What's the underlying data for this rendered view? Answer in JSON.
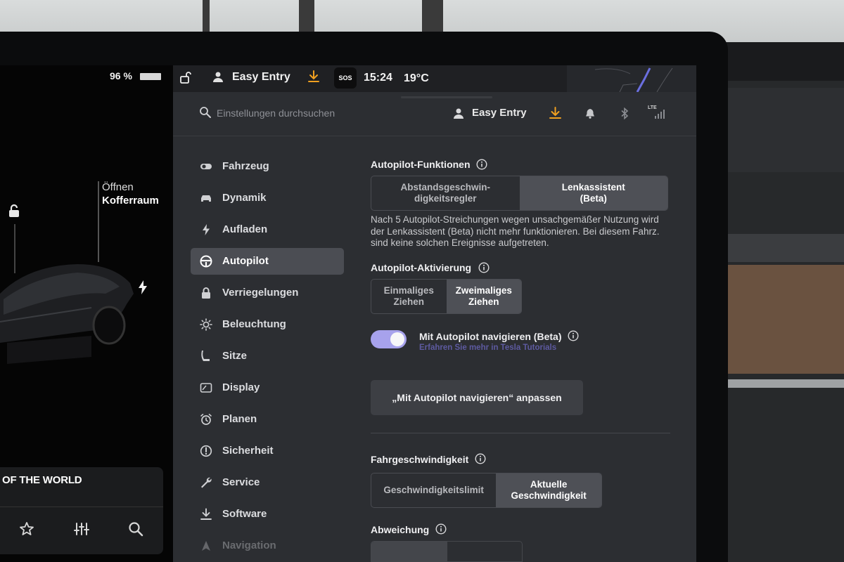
{
  "left_panel": {
    "battery_percent": "96 %",
    "trunk_label_line1": "Öffnen",
    "trunk_label_line2": "Kofferraum",
    "media_title": "OF THE WORLD",
    "media_controls": [
      "star-icon",
      "equalizer-icon",
      "search-icon"
    ]
  },
  "status_bar": {
    "profile": "Easy Entry",
    "sos": "SOS",
    "time": "15:24",
    "temperature": "19°C",
    "download_color": "#f0a020"
  },
  "header": {
    "search_placeholder": "Einstellungen durchsuchen",
    "profile": "Easy Entry",
    "lte": "LTE"
  },
  "sidebar": {
    "items": [
      {
        "label": "Fahrzeug",
        "icon": "toggle-icon"
      },
      {
        "label": "Dynamik",
        "icon": "car-icon"
      },
      {
        "label": "Aufladen",
        "icon": "bolt-icon"
      },
      {
        "label": "Autopilot",
        "icon": "steering-wheel-icon",
        "active": true
      },
      {
        "label": "Verriegelungen",
        "icon": "lock-icon"
      },
      {
        "label": "Beleuchtung",
        "icon": "sun-icon"
      },
      {
        "label": "Sitze",
        "icon": "seat-icon"
      },
      {
        "label": "Display",
        "icon": "display-icon"
      },
      {
        "label": "Planen",
        "icon": "alarm-clock-icon"
      },
      {
        "label": "Sicherheit",
        "icon": "alert-circle-icon"
      },
      {
        "label": "Service",
        "icon": "wrench-icon"
      },
      {
        "label": "Software",
        "icon": "download-icon"
      },
      {
        "label": "Navigation",
        "icon": "navigation-icon"
      }
    ]
  },
  "content": {
    "autopilot_features": {
      "title": "Autopilot-Funktionen",
      "options": [
        "Abstandsgeschwin-\ndigkeitsregler",
        "Lenkassistent\n(Beta)"
      ],
      "selected": 1
    },
    "description": "Nach 5 Autopilot-Streichungen wegen unsachgemäßer Nutzung wird der Lenkassistent (Beta) nicht mehr funktionieren. Bei diesem Fahrz. sind keine solchen Ereignisse aufgetreten.",
    "activation": {
      "title": "Autopilot-Aktivierung",
      "options": [
        "Einmaliges\nZiehen",
        "Zweimaliges\nZiehen"
      ],
      "selected": 1
    },
    "navigate_toggle": {
      "label": "Mit Autopilot navigieren (Beta)",
      "sublabel": "Erfahren Sie mehr in Tesla Tutorials",
      "on": true,
      "color": "#a7a2ec"
    },
    "customize_button": "„Mit Autopilot navigieren“ anpassen",
    "speed": {
      "title": "Fahrgeschwindigkeit",
      "options": [
        "Geschwindigkeitslimit",
        "Aktuelle\nGeschwindigkeit"
      ],
      "selected": 1
    },
    "offset": {
      "title": "Abweichung"
    }
  }
}
